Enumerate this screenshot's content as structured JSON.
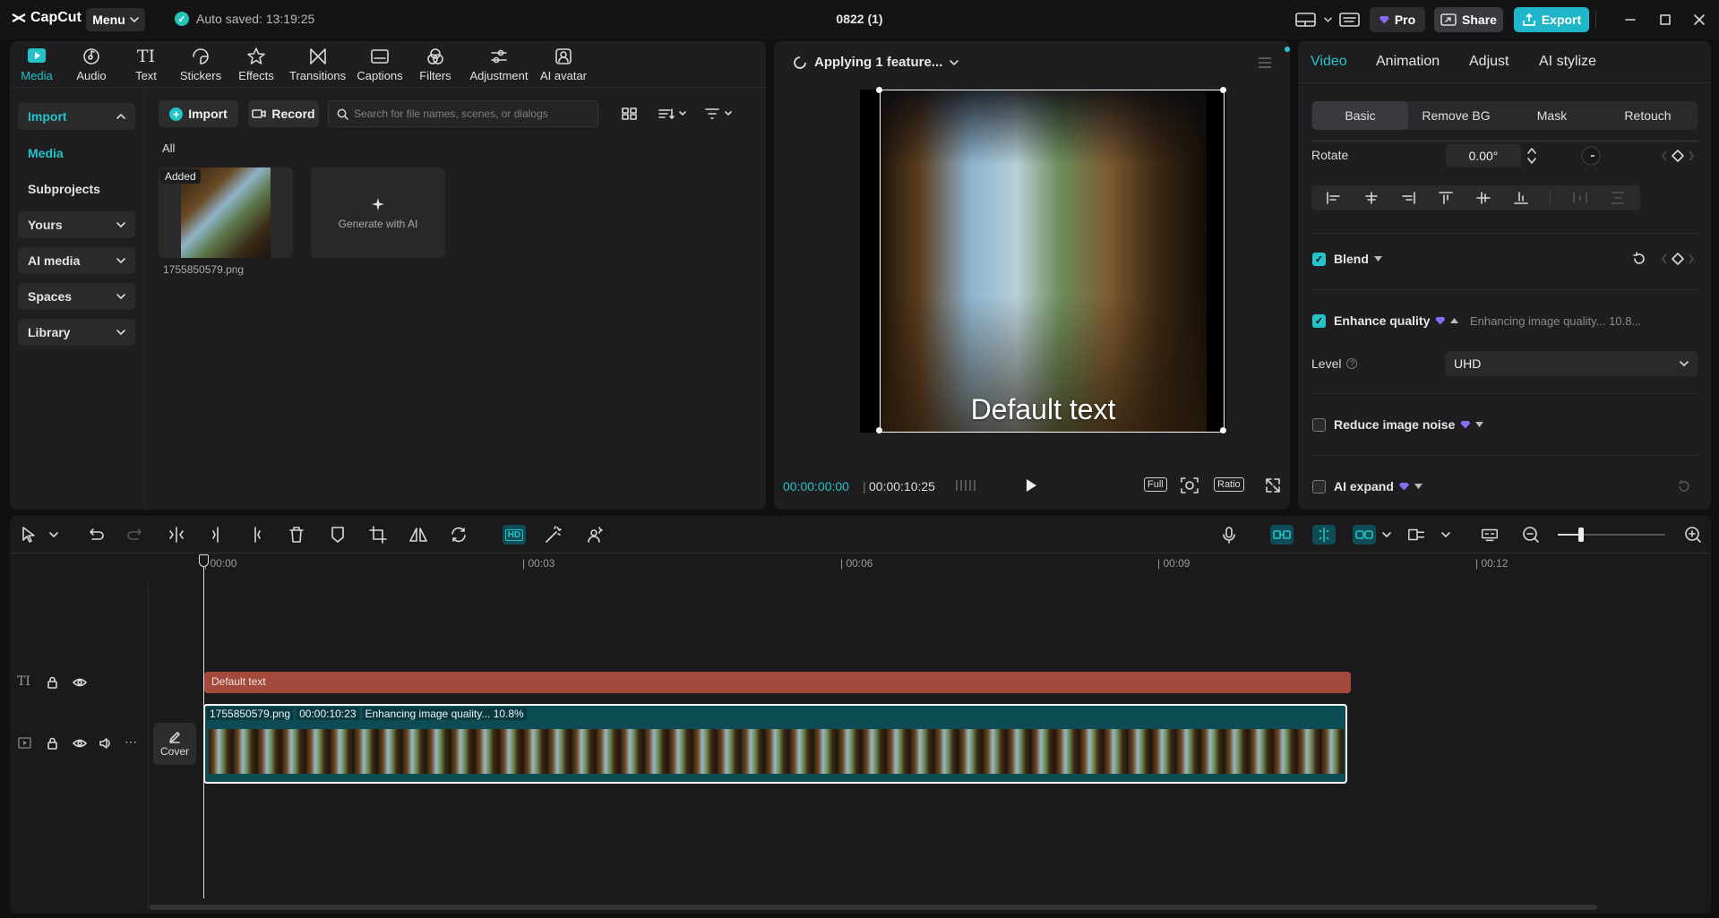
{
  "app": {
    "logo": "CapCut",
    "menu_label": "Menu",
    "autosave": "Auto saved: 13:19:25",
    "project_title": "0822 (1)"
  },
  "top_right": {
    "pro_label": "Pro",
    "share_label": "Share",
    "export_label": "Export"
  },
  "media_tabs": [
    {
      "label": "Media",
      "icon": "media-icon"
    },
    {
      "label": "Audio",
      "icon": "audio-icon"
    },
    {
      "label": "Text",
      "icon": "text-icon"
    },
    {
      "label": "Stickers",
      "icon": "stickers-icon"
    },
    {
      "label": "Effects",
      "icon": "effects-icon"
    },
    {
      "label": "Transitions",
      "icon": "transitions-icon"
    },
    {
      "label": "Captions",
      "icon": "captions-icon"
    },
    {
      "label": "Filters",
      "icon": "filters-icon"
    },
    {
      "label": "Adjustment",
      "icon": "adjustment-icon"
    },
    {
      "label": "AI avatar",
      "icon": "ai-avatar-icon"
    }
  ],
  "sidebar": {
    "items": [
      {
        "label": "Import"
      },
      {
        "label": "Media"
      },
      {
        "label": "Subprojects"
      },
      {
        "label": "Yours"
      },
      {
        "label": "AI media"
      },
      {
        "label": "Spaces"
      },
      {
        "label": "Library"
      }
    ]
  },
  "media_panel": {
    "import_label": "Import",
    "record_label": "Record",
    "search_placeholder": "Search for file names, scenes, or dialogs",
    "filter_all": "All",
    "asset": {
      "badge": "Added",
      "filename": "1755850579.png"
    },
    "generate_label": "Generate with AI"
  },
  "player": {
    "status": "Applying 1 feature...",
    "overlay_text": "Default text",
    "current_time": "00:00:00:00",
    "total_time": "00:00:10:25",
    "full_label": "Full",
    "ratio_label": "Ratio"
  },
  "inspector": {
    "tabs": [
      "Video",
      "Animation",
      "Adjust",
      "AI stylize"
    ],
    "subtabs": [
      "Basic",
      "Remove BG",
      "Mask",
      "Retouch"
    ],
    "rotate_label": "Rotate",
    "rotate_value": "0.00°",
    "blend_label": "Blend",
    "enhance_label": "Enhance quality",
    "enhance_status": "Enhancing image quality... 10.8...",
    "level_label": "Level",
    "level_value": "UHD",
    "noise_label": "Reduce image noise",
    "expand_label": "AI expand"
  },
  "timeline": {
    "ticks": [
      "00:00",
      "00:03",
      "00:06",
      "00:09",
      "00:12"
    ],
    "text_clip": "Default text",
    "video_clip": {
      "name": "1755850579.png",
      "duration": "00:00:10:23",
      "status": "Enhancing image quality... 10.8%"
    },
    "cover_label": "Cover"
  },
  "colors": {
    "accent": "#24c3c8",
    "export": "#1fb6c9",
    "text_clip": "#a34a3c",
    "video_clip": "#0e4c55",
    "pro": "#8b6bf5"
  }
}
